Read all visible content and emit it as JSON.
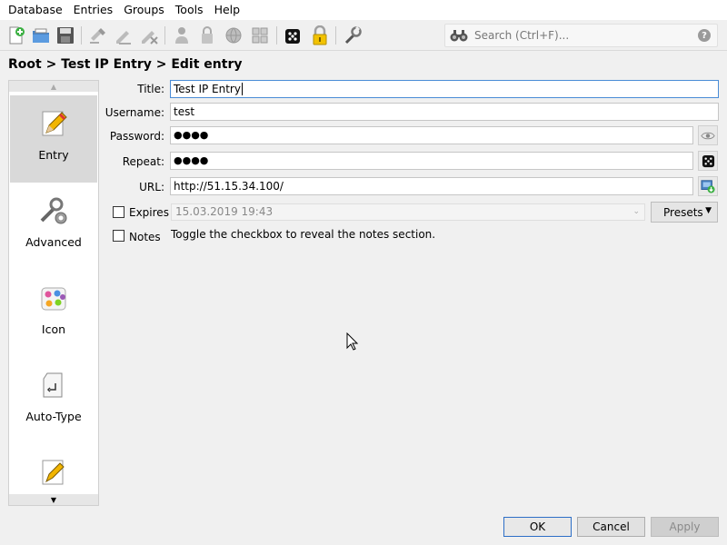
{
  "menu": [
    "Database",
    "Entries",
    "Groups",
    "Tools",
    "Help"
  ],
  "toolbar": {
    "icons": [
      "new-database-icon",
      "open-database-icon",
      "save-database-icon",
      "add-entry-icon",
      "edit-entry-icon",
      "delete-entry-icon",
      "copy-username-icon",
      "copy-password-icon",
      "open-url-icon",
      "autotype-icon",
      "password-generator-icon",
      "lock-database-icon",
      "settings-icon"
    ]
  },
  "search": {
    "placeholder": "Search (Ctrl+F)...",
    "help": "?"
  },
  "breadcrumb": "Root > Test IP Entry > Edit entry",
  "sidebar": {
    "items": [
      {
        "label": "Entry",
        "icon": "pencil-icon"
      },
      {
        "label": "Advanced",
        "icon": "wrench-gear-icon"
      },
      {
        "label": "Icon",
        "icon": "palette-icon"
      },
      {
        "label": "Auto-Type",
        "icon": "keyboard-key-icon"
      },
      {
        "label": "",
        "icon": "document-pencil-icon"
      }
    ]
  },
  "form": {
    "title_label": "Title:",
    "title_value": "Test IP Entry",
    "username_label": "Username:",
    "username_value": "test",
    "password_label": "Password:",
    "password_value": "●●●●",
    "repeat_label": "Repeat:",
    "repeat_value": "●●●●",
    "url_label": "URL:",
    "url_value": "http://51.15.34.100/",
    "expires_label": "Expires",
    "expires_value": "15.03.2019 19:43",
    "presets_label": "Presets",
    "notes_label": "Notes",
    "notes_hint": "Toggle the checkbox to reveal the notes section."
  },
  "buttons": {
    "ok": "OK",
    "cancel": "Cancel",
    "apply": "Apply"
  }
}
